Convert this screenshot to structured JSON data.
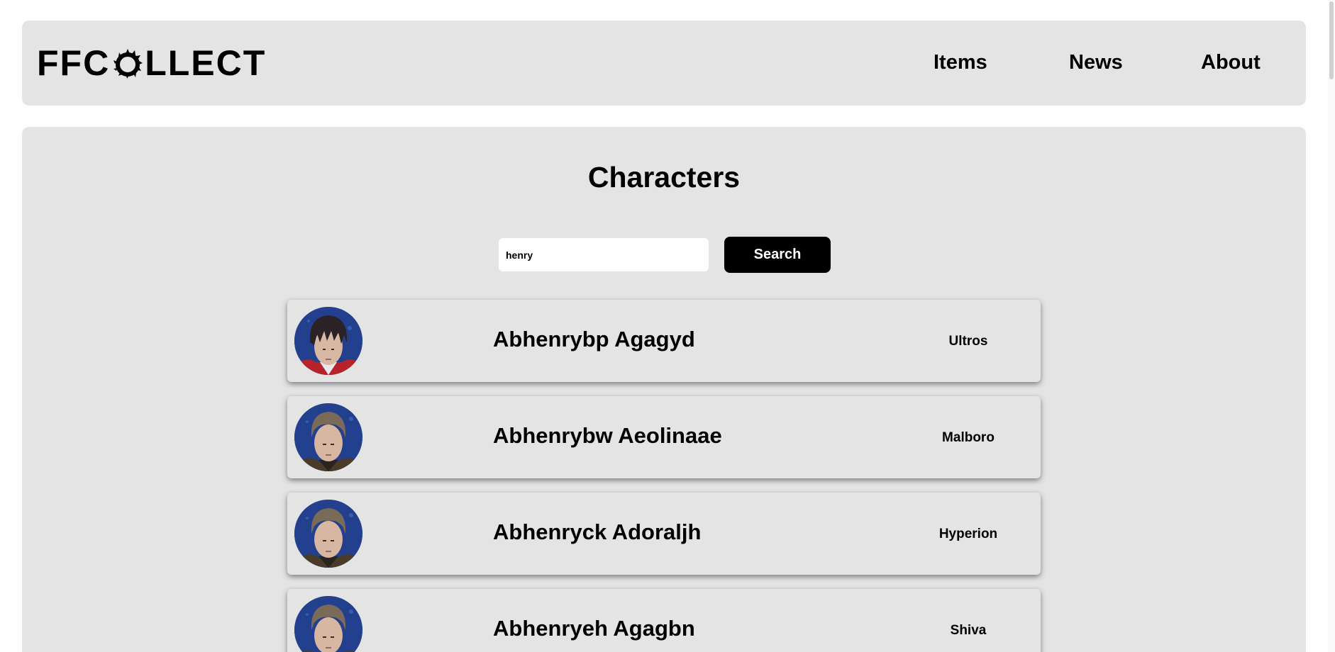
{
  "header": {
    "logo_prefix": "FFC",
    "logo_suffix": "LLECT",
    "logo_icon": "meteor-ring-icon",
    "nav": [
      {
        "label": "Items"
      },
      {
        "label": "News"
      },
      {
        "label": "About"
      }
    ]
  },
  "main": {
    "title": "Characters",
    "search": {
      "value": "henry",
      "button_label": "Search"
    },
    "characters": [
      {
        "name": "Abhenrybp Agagyd",
        "server": "Ultros",
        "avatar": "dark-hair-portrait"
      },
      {
        "name": "Abhenrybw Aeolinaae",
        "server": "Malboro",
        "avatar": "light-hair-portrait"
      },
      {
        "name": "Abhenryck Adoraljh",
        "server": "Hyperion",
        "avatar": "light-hair-portrait"
      },
      {
        "name": "Abhenryeh Agagbn",
        "server": "Shiva",
        "avatar": "light-hair-portrait"
      }
    ]
  },
  "colors": {
    "panel_bg": "#e4e4e4",
    "button_bg": "#000000",
    "button_text": "#ffffff",
    "avatar_bg": "#23408f"
  }
}
